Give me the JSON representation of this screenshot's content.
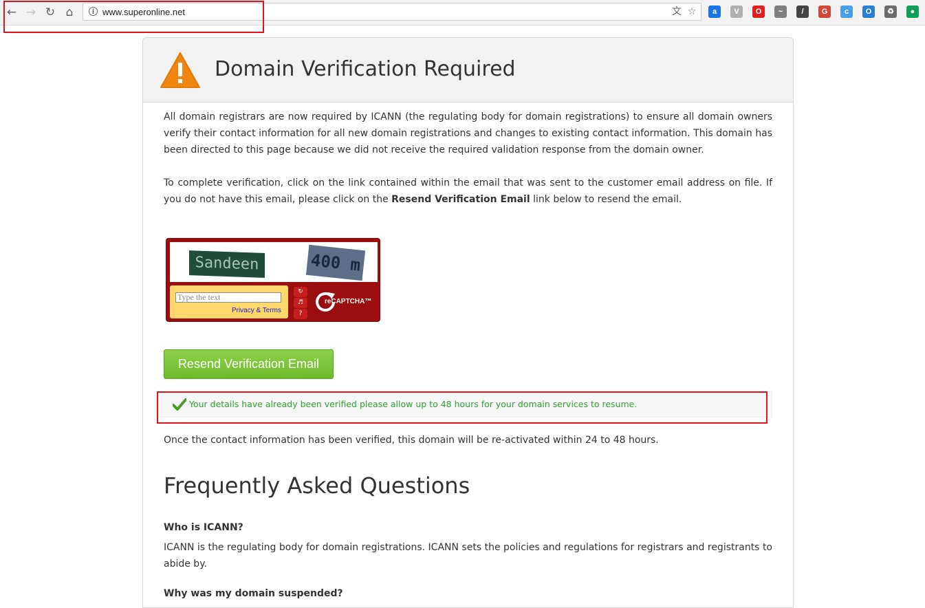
{
  "browser": {
    "url": "www.superonline.net",
    "extensions": [
      {
        "name": "a-icon",
        "color": "#1a73e8",
        "glyph": "a"
      },
      {
        "name": "shield-icon",
        "color": "#b0b0b0",
        "glyph": "V"
      },
      {
        "name": "opera-icon",
        "color": "#e02020",
        "glyph": "O"
      },
      {
        "name": "chart-icon",
        "color": "#7f7f7f",
        "glyph": "~"
      },
      {
        "name": "eyedropper-icon",
        "color": "#444444",
        "glyph": "/"
      },
      {
        "name": "gmail-icon",
        "color": "#d44638",
        "glyph": "G"
      },
      {
        "name": "cloud-icon",
        "color": "#4a9ee8",
        "glyph": "c"
      },
      {
        "name": "outlook-icon",
        "color": "#2b7cd3",
        "glyph": "O"
      },
      {
        "name": "recycle-icon",
        "color": "#6b6b6b",
        "glyph": "♻"
      },
      {
        "name": "hangouts-icon",
        "color": "#0f9d58",
        "glyph": "●"
      }
    ]
  },
  "page": {
    "title": "Domain Verification Required",
    "para1": "All domain registrars are now required by ICANN (the regulating body for domain registrations) to ensure all domain owners verify their contact information for all new domain registrations and changes to existing contact information. This domain has been directed to this page because we did not receive the required validation response from the domain owner.",
    "para2_before": "To complete verification, click on the link contained within the email that was sent to the customer email address on file. If you do not have this email, please click on the ",
    "para2_bold": "Resend Verification Email",
    "para2_after": " link below to resend the email.",
    "captcha": {
      "word1": "Sandeen",
      "word2": "400 m",
      "placeholder": "Type the text",
      "privacy": "Privacy & Terms",
      "brand": "reCAPTCHA™"
    },
    "resend_button": "Resend Verification Email",
    "notice": "Your details have already been verified please allow up to 48 hours for your domain services to resume.",
    "para3": "Once the contact information has been verified, this domain will be re-activated within 24 to 48 hours.",
    "faq_title": "Frequently Asked Questions",
    "faq": [
      {
        "q": "Who is ICANN?",
        "a": "ICANN is the regulating body for domain registrations. ICANN sets the policies and regulations for registrars and registrants to abide by."
      },
      {
        "q": "Why was my domain suspended?",
        "a": ""
      }
    ]
  },
  "colors": {
    "warning": "#f0860f",
    "button_green": "#7cc43c",
    "notice_green": "#2fa12f",
    "annotation_red": "#e0121d"
  }
}
